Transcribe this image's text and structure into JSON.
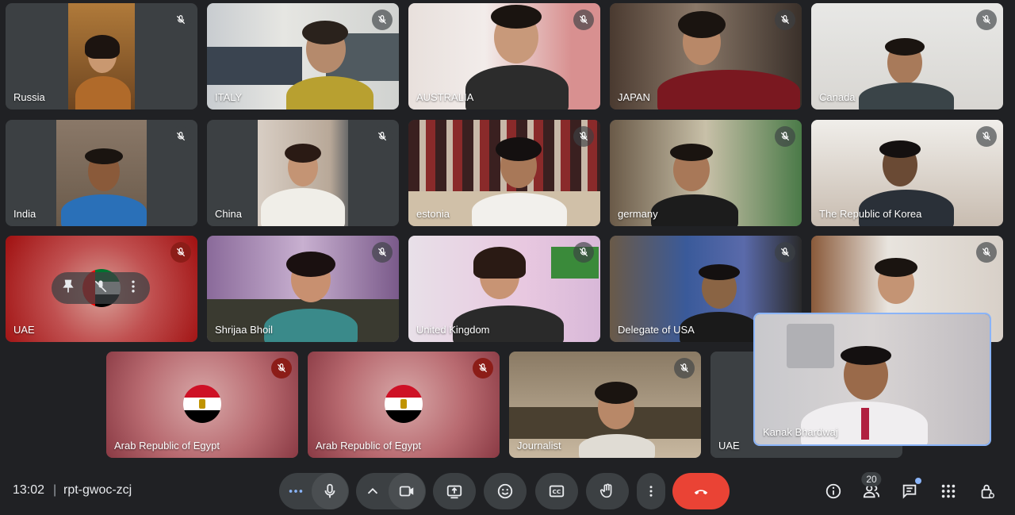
{
  "meeting": {
    "time": "13:02",
    "separator": "|",
    "code": "rpt-gwoc-zcj"
  },
  "participants": {
    "p1": "Russia",
    "p2": "ITALY",
    "p3": "AUSTRALIA",
    "p4": "JAPAN",
    "p5": "Canada",
    "p6": "India",
    "p7": "China",
    "p8": "estonia",
    "p9": "germany",
    "p10": "The Republic of Korea",
    "p11": "UAE",
    "p12": "Shrijaa Bhoil",
    "p13": "United Kingdom",
    "p14": "Delegate of USA",
    "p15": "Arab Republic of Egypt",
    "p16": "Arab Republic of Egypt",
    "p17": "Journalist",
    "p18": "UAE",
    "self": "Kanak Bhardwaj"
  },
  "controls": {
    "people_count": "20"
  },
  "colors": {
    "hangup": "#ea4335",
    "tile": "#3c4043",
    "background": "#202124",
    "accent": "#8ab4f8"
  },
  "icons": [
    "mic-off-icon",
    "pin-icon",
    "more-vert-icon",
    "mic-icon",
    "chevron-up-icon",
    "camera-icon",
    "present-icon",
    "emoji-icon",
    "captions-icon",
    "raise-hand-icon",
    "hangup-icon",
    "info-icon",
    "people-icon",
    "chat-icon",
    "apps-icon",
    "host-controls-icon"
  ]
}
